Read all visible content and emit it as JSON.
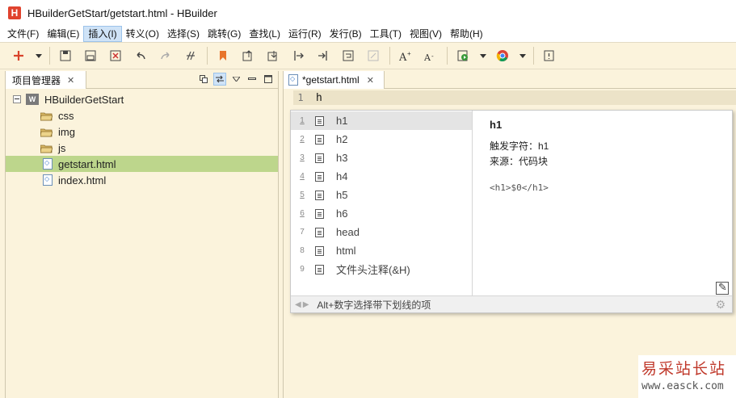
{
  "window": {
    "title": "HBuilderGetStart/getstart.html  -  HBuilder",
    "app_icon": "H"
  },
  "menu": [
    "文件(F)",
    "编辑(E)",
    "插入(I)",
    "转义(O)",
    "选择(S)",
    "跳转(G)",
    "查找(L)",
    "运行(R)",
    "发行(B)",
    "工具(T)",
    "视图(V)",
    "帮助(H)"
  ],
  "menu_active_index": 2,
  "left_panel": {
    "tab_label": "项目管理器",
    "tree": [
      {
        "label": "HBuilderGetStart",
        "type": "project"
      },
      {
        "label": "css",
        "type": "folder"
      },
      {
        "label": "img",
        "type": "folder"
      },
      {
        "label": "js",
        "type": "folder"
      },
      {
        "label": "getstart.html",
        "type": "file",
        "selected": true
      },
      {
        "label": "index.html",
        "type": "file"
      }
    ]
  },
  "editor": {
    "tab_label": "*getstart.html",
    "line_number": "1",
    "code": "h"
  },
  "autocomplete": {
    "items": [
      {
        "num": "1",
        "label": "h1"
      },
      {
        "num": "2",
        "label": "h2"
      },
      {
        "num": "3",
        "label": "h3"
      },
      {
        "num": "4",
        "label": "h4"
      },
      {
        "num": "5",
        "label": "h5"
      },
      {
        "num": "6",
        "label": "h6"
      },
      {
        "num": "7",
        "label": "head"
      },
      {
        "num": "8",
        "label": "html"
      },
      {
        "num": "9",
        "label": "文件头注释(&H)"
      }
    ],
    "selected_index": 0,
    "detail": {
      "title": "h1",
      "trigger": "触发字符：h1",
      "source": "来源：代码块",
      "code": "<h1>$0</h1>"
    },
    "status": "Alt+数字选择带下划线的项"
  },
  "watermark": {
    "text": "易采站长站",
    "url": "www.easck.com"
  },
  "colors": {
    "accent_red": "#e0432e",
    "selection_green": "#bdd68c",
    "editor_bg": "#fbf3dc"
  }
}
